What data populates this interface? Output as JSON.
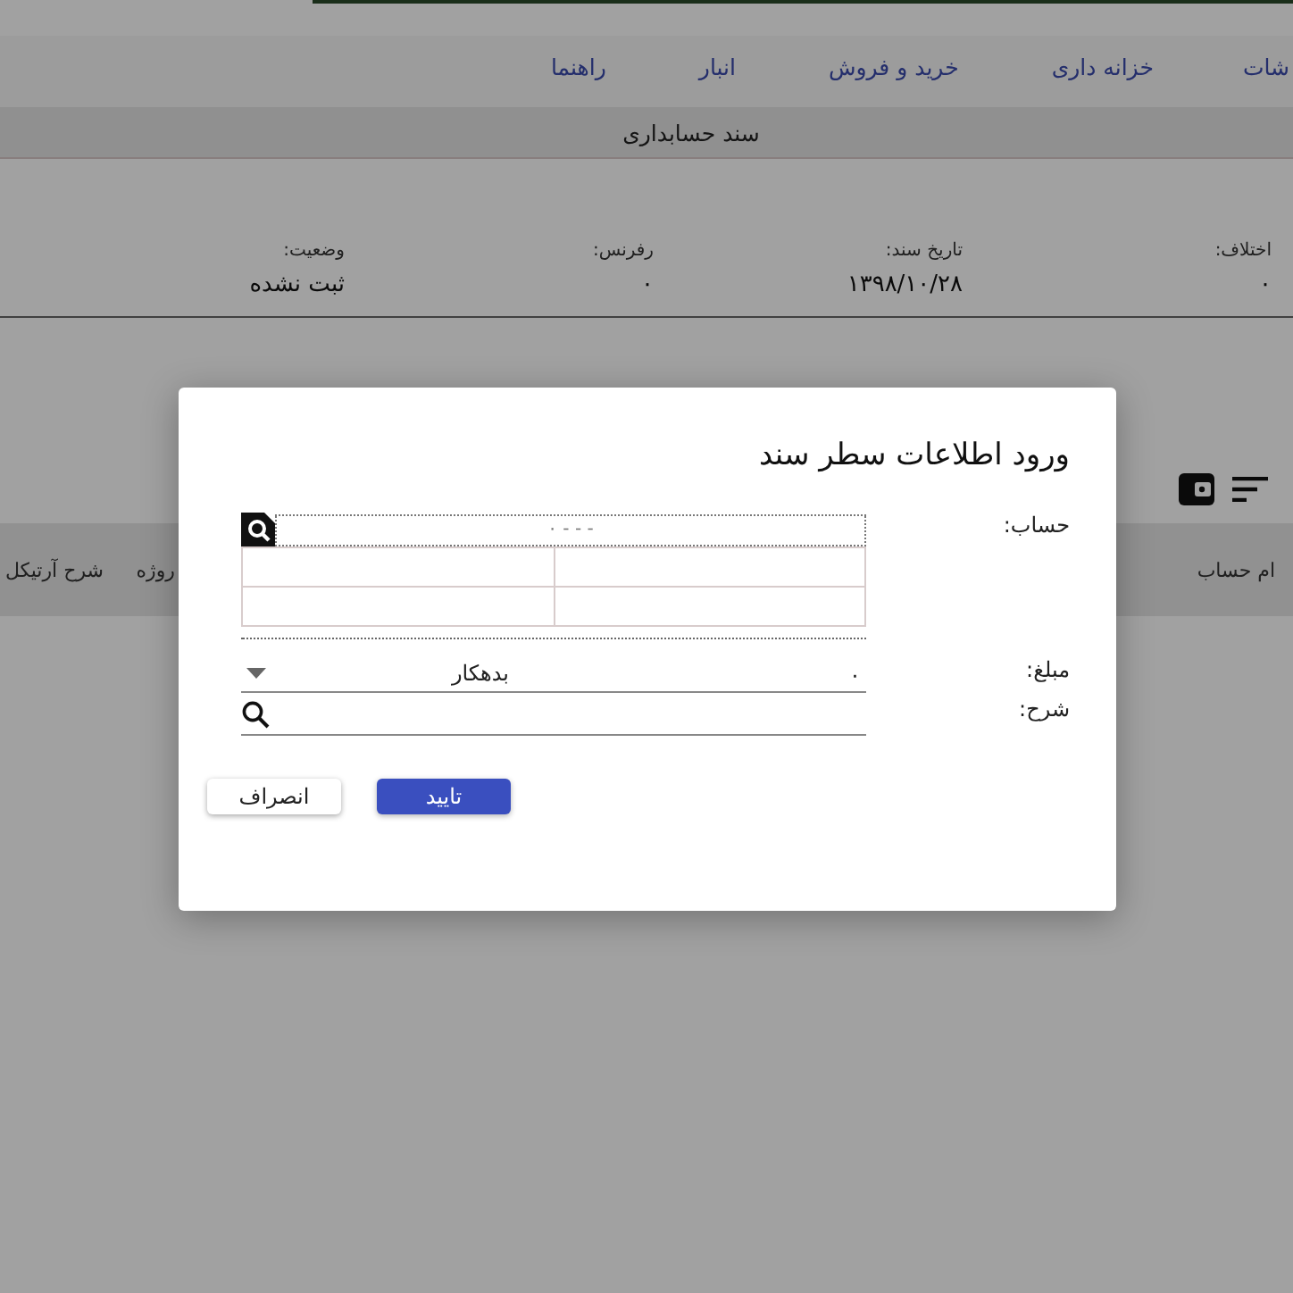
{
  "menu": [
    "شات",
    "خزانه داری",
    "خرید و فروش",
    "انبار",
    "راهنما"
  ],
  "page_title": "سند حسابداری",
  "info_fields": [
    {
      "label": "اختلاف:",
      "value": "۰"
    },
    {
      "label": "تاریخ سند:",
      "value": "۱۳۹۸/۱۰/۲۸"
    },
    {
      "label": "رفرنس:",
      "value": "۰"
    },
    {
      "label": "وضعیت:",
      "value": "ثبت نشده"
    }
  ],
  "table_headers": [
    "ام حساب",
    "روژه",
    "شرح آرتیکل"
  ],
  "dialog": {
    "title": "ورود اطلاعات سطر سند",
    "account": {
      "label": "حساب:",
      "placeholder": "۰ - - -"
    },
    "amount": {
      "label": "مبلغ:",
      "value": "۰",
      "side": "بدهکار"
    },
    "description": {
      "label": "شرح:"
    },
    "buttons": [
      {
        "label": "تایید",
        "kind": "primary"
      },
      {
        "label": "انصراف",
        "kind": "secondary"
      }
    ]
  }
}
